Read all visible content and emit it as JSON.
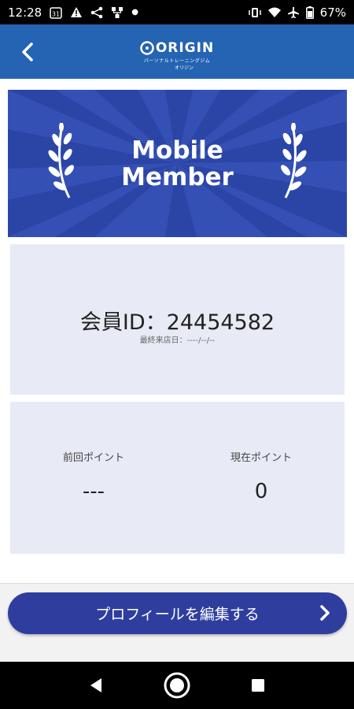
{
  "status_bar": {
    "time": "12:28",
    "calendar_day": "31",
    "battery": "67%"
  },
  "app_bar": {
    "logo_text": "ORIGIN",
    "logo_kana": "オリジン",
    "logo_sub": "パーソナルトレーニングジム"
  },
  "banner": {
    "title_line1": "Mobile",
    "title_line2": "Member"
  },
  "member": {
    "id_text": "会員ID：24454582",
    "last_visit": "最終来店日：----/--/--"
  },
  "points": {
    "previous_label": "前回ポイント",
    "previous_value": "---",
    "current_label": "現在ポイント",
    "current_value": "0"
  },
  "actions": {
    "edit_profile_label": "プロフィールを編集する"
  },
  "colors": {
    "app_bar": "#2563b3",
    "banner": "#3550b5",
    "button": "#2f3e9e",
    "card": "#e8ebf6"
  }
}
